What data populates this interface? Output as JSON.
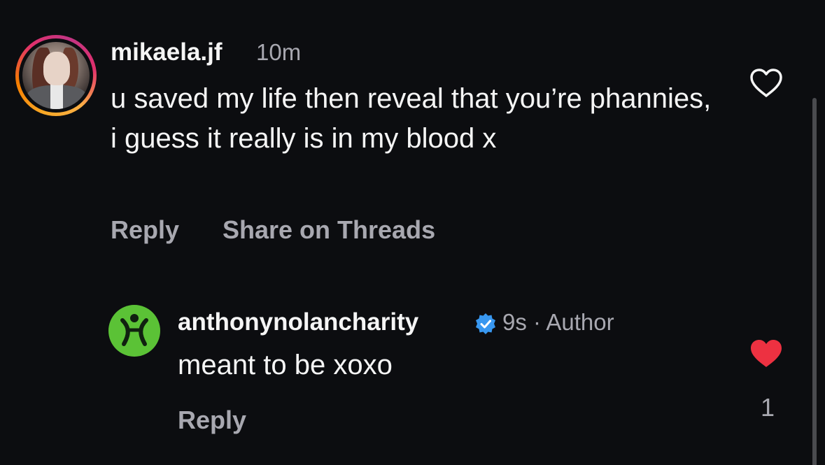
{
  "comments": [
    {
      "username": "mikaela.jf",
      "time": "10m",
      "text": "u saved my life then reveal that you’re phannies, i guess it really is in my blood x",
      "actions": {
        "reply": "Reply",
        "share": "Share on Threads"
      },
      "liked": false,
      "icons": {
        "like": "heart-outline-icon"
      }
    },
    {
      "username": "anthonynolancharity",
      "verified": true,
      "time": "9s",
      "separator": "·",
      "tag": "Author",
      "text": "meant to be xoxo",
      "actions": {
        "reply": "Reply"
      },
      "liked": true,
      "like_count": "1",
      "icons": {
        "like": "heart-filled-icon",
        "badge": "verified-badge-icon"
      }
    }
  ],
  "colors": {
    "background": "#0c0d10",
    "primary_text": "#f5f5f5",
    "secondary_text": "#a8a8b0",
    "liked_heart": "#ed3141",
    "verified_blue": "#3897f0",
    "charity_green": "#5bc236"
  }
}
